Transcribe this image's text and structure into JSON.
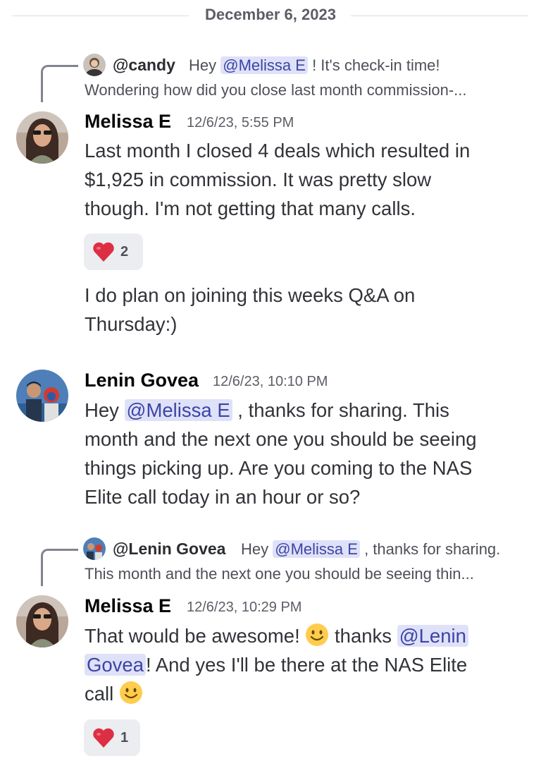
{
  "date_divider": "December 6, 2023",
  "messages": [
    {
      "reply": {
        "user": "@candy",
        "text_pre": "Hey ",
        "mention": "@Melissa E",
        "text_post": " ! It's check-in time!",
        "preview": "Wondering how did you close last month commission-..."
      },
      "author": "Melissa E",
      "timestamp": "12/6/23, 5:55 PM",
      "lines": [
        "Last month I closed 4 deals which resulted in",
        "$1,925 in commission. It was pretty slow",
        "though. I'm not getting that many calls."
      ],
      "reaction": {
        "emoji": "heart",
        "count": "2"
      },
      "followup_lines": [
        "I do plan on joining this weeks Q&A on",
        "Thursday:)"
      ]
    },
    {
      "author": "Lenin Govea",
      "timestamp": "12/6/23, 10:10 PM",
      "line1_pre": "Hey ",
      "line1_mention": "@Melissa E",
      "line1_post": " , thanks for sharing. This",
      "lines": [
        "month and the next one you should be seeing",
        "things picking up. Are you coming to the NAS",
        "Elite call today in an hour or so?"
      ]
    },
    {
      "reply": {
        "user": "@Lenin Govea",
        "text_pre": "Hey ",
        "mention": "@Melissa E",
        "text_post": " , thanks for sharing.",
        "preview": "This month and the next one you should be seeing thin..."
      },
      "author": "Melissa E",
      "timestamp": "12/6/23, 10:29 PM",
      "line1_pre": "That would be awesome! ",
      "line1_mid": " thanks ",
      "line1_mention": "@Lenin",
      "line2_mention": "Govea",
      "line2_post": "! And yes I'll be there at the NAS Elite",
      "line3_pre": "call ",
      "reaction": {
        "emoji": "heart",
        "count": "1"
      }
    }
  ]
}
